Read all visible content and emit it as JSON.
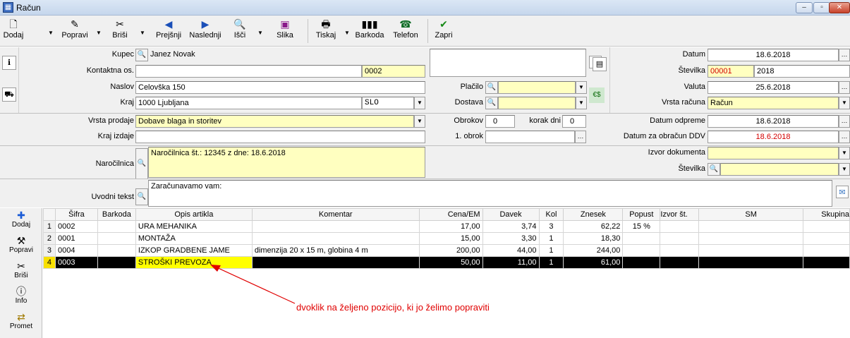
{
  "window": {
    "title": "Račun"
  },
  "toolbar": {
    "dodaj": "Dodaj",
    "popravi": "Popravi",
    "brisi": "Briši",
    "prejsnji": "Prejšnji",
    "naslednji": "Naslednji",
    "isci": "Išči",
    "slika": "Slika",
    "tiskaj": "Tiskaj",
    "barkoda": "Barkoda",
    "telefon": "Telefon",
    "zapri": "Zapri"
  },
  "customer": {
    "kupec_label": "Kupec",
    "kupec": "Janez Novak",
    "kontakt_label": "Kontaktna os.",
    "kontakt": "",
    "code": "0002",
    "naslov_label": "Naslov",
    "naslov": "Celovška 150",
    "kraj_label": "Kraj",
    "kraj": "1000 Ljubljana",
    "country": "SLO"
  },
  "payment": {
    "placilo_label": "Plačilo",
    "placilo": "",
    "dostava_label": "Dostava",
    "dostava": ""
  },
  "document": {
    "datum_label": "Datum",
    "datum": "18.6.2018",
    "stevilka_label": "Številka",
    "stevilka": "00001",
    "leto": "2018",
    "valuta_label": "Valuta",
    "valuta": "25.6.2018",
    "vrsta_label": "Vrsta računa",
    "vrsta": "Račun"
  },
  "sale": {
    "vrsta_prodaje_label": "Vrsta prodaje",
    "vrsta_prodaje": "Dobave blaga in storitev",
    "kraj_izdaje_label": "Kraj izdaje",
    "kraj_izdaje": "",
    "obrokov_label": "Obrokov",
    "obrokov": "0",
    "korak_label": "korak dni",
    "korak": "0",
    "prvi_obrok_label": "1. obrok",
    "prvi_obrok": "",
    "odprema_label": "Datum odpreme",
    "odprema": "18.6.2018",
    "ddv_label": "Datum za obračun DDV",
    "ddv": "18.6.2018"
  },
  "order": {
    "label": "Naročilnica",
    "text": "Naročilnica št.: 12345 z dne: 18.6.2018",
    "izvor_label": "Izvor dokumenta",
    "izvor": "",
    "stevilka_label": "Številka",
    "stevilka": ""
  },
  "intro": {
    "label": "Uvodni tekst",
    "text": "Zaračunavamo vam:"
  },
  "grid": {
    "headers": [
      "",
      "Šifra",
      "Barkoda",
      "Opis artikla",
      "Komentar",
      "Cena/EM",
      "Davek",
      "Kol",
      "Znesek",
      "Popust",
      "Izvor št.",
      "SM",
      "Skupina"
    ],
    "rows": [
      {
        "n": "1",
        "sifra": "0002",
        "barkoda": "",
        "opis": "URA MEHANIKA",
        "komentar": "",
        "cena": "17,00",
        "davek": "3,74",
        "kol": "3",
        "znesek": "62,22",
        "popust": "15 %",
        "izvor": "",
        "sm": "",
        "skupina": ""
      },
      {
        "n": "2",
        "sifra": "0001",
        "barkoda": "",
        "opis": "MONTAŽA",
        "komentar": "",
        "cena": "15,00",
        "davek": "3,30",
        "kol": "1",
        "znesek": "18,30",
        "popust": "",
        "izvor": "",
        "sm": "",
        "skupina": ""
      },
      {
        "n": "3",
        "sifra": "0004",
        "barkoda": "",
        "opis": "IZKOP GRADBENE JAME",
        "komentar": "dimenzija 20 x 15 m, globina 4 m",
        "cena": "200,00",
        "davek": "44,00",
        "kol": "1",
        "znesek": "244,00",
        "popust": "",
        "izvor": "",
        "sm": "",
        "skupina": ""
      },
      {
        "n": "4",
        "sifra": "0003",
        "barkoda": "",
        "opis": "STROŠKI PREVOZA",
        "komentar": "",
        "cena": "50,00",
        "davek": "11,00",
        "kol": "1",
        "znesek": "61,00",
        "popust": "",
        "izvor": "",
        "sm": "",
        "skupina": ""
      }
    ]
  },
  "sidebar": {
    "dodaj": "Dodaj",
    "popravi": "Popravi",
    "brisi": "Briši",
    "info": "Info",
    "promet": "Promet"
  },
  "annotation": "dvoklik na željeno pozicijo, ki jo želimo popraviti",
  "colors": {
    "accent_yellow": "#ffffc0",
    "selected_row": "#000000",
    "highlight": "#ffff00",
    "annotation": "#e00000"
  }
}
